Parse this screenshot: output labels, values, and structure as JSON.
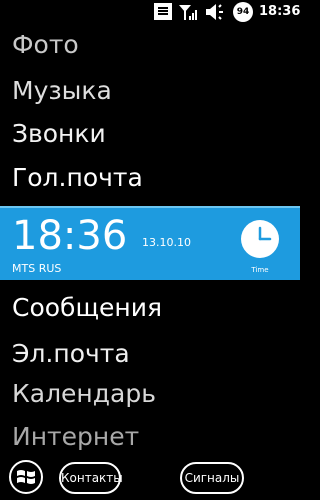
{
  "status_bar": {
    "time": "18:36",
    "battery": "94",
    "icons": [
      "message-icon",
      "signal-icon",
      "volume-icon",
      "battery-icon"
    ]
  },
  "menu": {
    "items": [
      {
        "label": "Фото",
        "color": "#c9c9c9"
      },
      {
        "label": "Музыка",
        "color": "#dedede"
      },
      {
        "label": "Звонки",
        "color": "#f2f2f2"
      },
      {
        "label": "Гол.почта",
        "color": "#ffffff"
      },
      {
        "label": "Сообщения",
        "color": "#ffffff"
      },
      {
        "label": "Эл.почта",
        "color": "#f0f0f0"
      },
      {
        "label": "Календарь",
        "color": "#d8d8d8"
      },
      {
        "label": "Интернет",
        "color": "#a8a8a8"
      }
    ]
  },
  "clock_panel": {
    "time": "18:36",
    "date": "13.10.10",
    "operator": "MTS RUS",
    "icon": "clock-icon",
    "icon_label": "Time",
    "background": "#1e9bdf"
  },
  "softkeys": {
    "start_icon": "windows-icon",
    "left": "Контакты",
    "right": "Сигналы"
  }
}
